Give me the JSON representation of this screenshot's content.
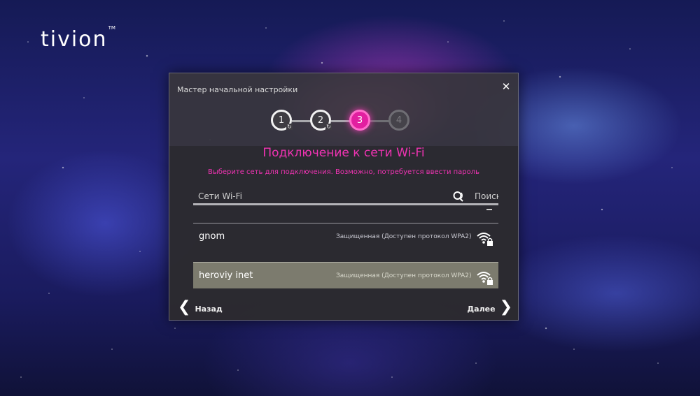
{
  "brand": {
    "logo_text": "tivion",
    "trademark": "TM"
  },
  "dialog": {
    "title": "Мастер начальной настройки",
    "close_glyph": "✕",
    "steps": [
      {
        "label": "1",
        "state": "done"
      },
      {
        "label": "2",
        "state": "done"
      },
      {
        "label": "3",
        "state": "active"
      },
      {
        "label": "4",
        "state": "pending"
      }
    ],
    "heading": "Подключение к сети Wi-Fi",
    "subheading": "Выберите сеть для подключения. Возможно, потребуется ввести пароль",
    "search": {
      "label": "Сети Wi-Fi",
      "button": "Поиск"
    },
    "networks": [
      {
        "name": "gnom",
        "security": "Защищенная (Доступен протокол WPA2)",
        "selected": false
      },
      {
        "name": "heroviy inet",
        "security": "Защищенная (Доступен протокол WPA2)",
        "selected": true
      }
    ],
    "nav": {
      "back": "Назад",
      "next": "Далее"
    }
  },
  "colors": {
    "accent": "#f033b3",
    "step_active": "#e21fa0",
    "dialog_bg": "#38363c",
    "selected_row": "#7c7b6e"
  },
  "icons": {
    "close": "close-icon",
    "search": "search-icon",
    "wifi": "wifi-lock-icon",
    "back": "chevron-left-icon",
    "next": "chevron-right-icon"
  }
}
